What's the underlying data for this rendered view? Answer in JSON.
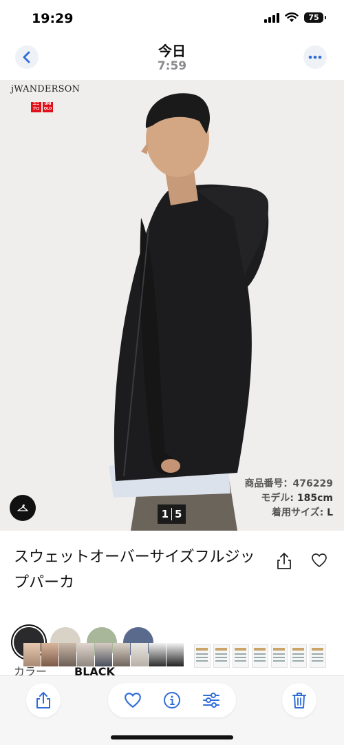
{
  "status_bar": {
    "time": "19:29",
    "battery": "75"
  },
  "header": {
    "title": "今日",
    "subtitle": "7:59"
  },
  "image": {
    "brand": "jWANDERSON",
    "logo_text": [
      "ユニ",
      "クロ",
      "UNI",
      "QLO"
    ],
    "product_number": "商品番号：476229",
    "model_height_label": "モデル: ",
    "model_height_value": "185cm",
    "size_label": "着用サイズ: ",
    "size_value": "L",
    "pager_current": "1",
    "pager_total": "5"
  },
  "product": {
    "name": "スウェットオーバーサイズフルジップパーカ",
    "color_label": "カラー",
    "color_value": "BLACK",
    "swatch_colors": [
      "#2a2a2c",
      "#d8d3c6",
      "#a8b79a",
      "#5a6a8c"
    ]
  },
  "icons": {
    "back": "chevron-left-icon",
    "more": "ellipsis-icon",
    "share": "share-icon",
    "favorite": "heart-icon",
    "info": "info-icon",
    "adjust": "sliders-icon",
    "delete": "trash-icon",
    "hanger": "hanger-icon"
  },
  "colors": {
    "accent": "#2f6cd8",
    "toolbar_bg": "#f6f6f7",
    "image_bg": "#efeeec"
  }
}
